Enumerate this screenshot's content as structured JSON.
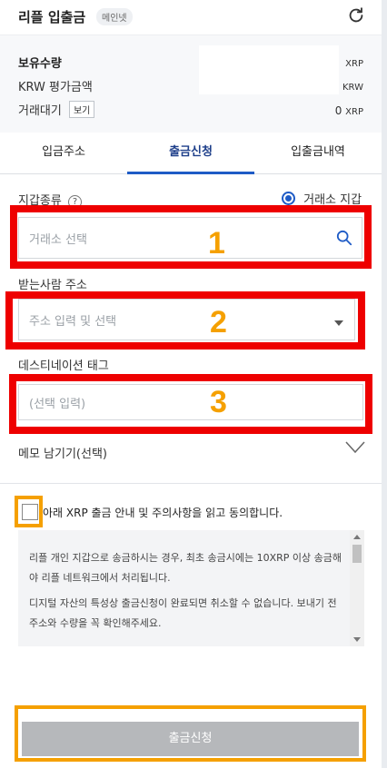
{
  "header": {
    "title": "리플 입출금",
    "badge": "메인넷",
    "refresh_icon": "refresh-icon"
  },
  "balance": {
    "holding_label": "보유수량",
    "holding_unit": "XRP",
    "krw_label": "KRW 평가금액",
    "krw_unit": "KRW",
    "pending_label": "거래대기",
    "view_button": "보기",
    "pending_value": "0",
    "pending_unit": "XRP"
  },
  "tabs": [
    {
      "label": "입금주소",
      "active": false
    },
    {
      "label": "출금신청",
      "active": true
    },
    {
      "label": "입출금내역",
      "active": false
    }
  ],
  "form": {
    "wallet_type_label": "지갑종류",
    "help_glyph": "?",
    "wallet_option": "거래소 지갑",
    "exchange_placeholder": "거래소 선택",
    "recipient_label": "받는사람 주소",
    "address_placeholder": "주소 입력 및 선택",
    "tag_label": "데스티네이션 태그",
    "tag_placeholder": "(선택 입력)",
    "memo_label": "메모 남기기(선택)"
  },
  "annotations": {
    "n1": "1",
    "n2": "2",
    "n3": "3"
  },
  "agreement": {
    "text": "아래 XRP 출금 안내 및 주의사항을 읽고 동의합니다.",
    "checked": false
  },
  "notice": {
    "p1": "리플 개인 지갑으로 송금하시는 경우, 최초 송금시에는 10XRP 이상 송금해야 리플 네트워크에서 처리됩니다.",
    "p2": "디지털 자산의 특성상 출금신청이 완료되면 취소할 수 없습니다. 보내기 전 주소와 수량을 꼭 확인해주세요."
  },
  "submit_label": "출금신청",
  "colors": {
    "accent": "#1e5bc6",
    "highlight_red": "#ee0000",
    "highlight_orange": "#f5a000",
    "disabled_button": "#b6b8bb"
  }
}
